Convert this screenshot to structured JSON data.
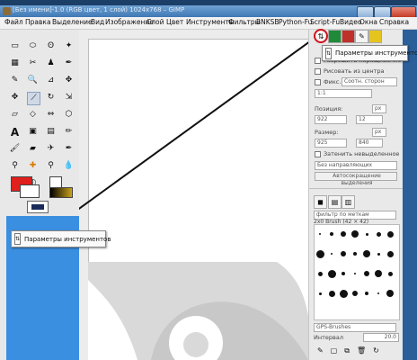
{
  "window": {
    "title": "[Без имени]-1.0 (RGB цвет, 1 слой) 1024x768 – GIMP"
  },
  "menubar": {
    "items": [
      "Файл",
      "Правка",
      "Выделение",
      "Вид",
      "Изображение",
      "Слой",
      "Цвет",
      "Инструменты",
      "Фильтры",
      "BNKSB",
      "Python-Fu",
      "Script-Fu",
      "Видео",
      "Окна",
      "Справка"
    ]
  },
  "toolbox": {
    "tools": [
      "rect-select",
      "ellipse-select",
      "free-select",
      "fuzzy-select",
      "color-select",
      "scissors",
      "foreground-select",
      "paths",
      "color-picker",
      "zoom",
      "measure",
      "move",
      "align",
      "crop",
      "rotate",
      "scale",
      "shear",
      "perspective",
      "flip",
      "cage",
      "text",
      "bucket-fill",
      "blend",
      "pencil",
      "paintbrush",
      "eraser",
      "airbrush",
      "ink",
      "clone",
      "heal",
      "perspective-clone",
      "blur",
      "smudge",
      "dodge-burn"
    ],
    "fg_color": "#e01f1f",
    "bg_color": "#ffffff"
  },
  "dock": {
    "tabs_tooltip": "Параметры инструментов",
    "options": {
      "antialias_label": "Разрешить наращивание",
      "center_label": "Рисовать из центра",
      "fixed_label": "Фикс.",
      "fixed_value": "Соотн. сторон",
      "ratio_value": "1:1",
      "position_label": "Позиция:",
      "position_x": "922",
      "position_y": "12",
      "position_unit": "px",
      "size_label": "Размер:",
      "size_w": "925",
      "size_h": "840",
      "size_unit": "px",
      "highlight_label": "Затенить невыделенное",
      "guides_value": "Без направляющих",
      "autoshrink_label": "Автосокращение выделения"
    },
    "brushes": {
      "filter_placeholder": "фильтр по меткам",
      "current_brush": "2x0 Brush (42 × 42)",
      "brush_set": "GPS-Brushes",
      "spacing_label": "Интервал",
      "spacing_value": "20.0"
    }
  },
  "tooltip_top": {
    "label": "Параметры инструментов"
  },
  "tooltip_main": {
    "label": "Параметры инструментов"
  },
  "colors": {
    "accent_circle": "#d0121b"
  }
}
